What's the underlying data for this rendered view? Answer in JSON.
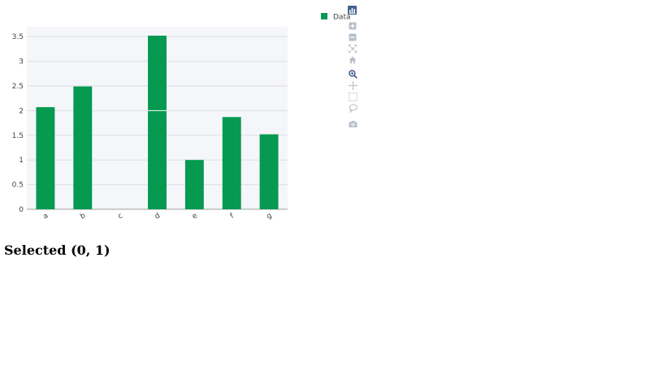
{
  "chart_data": {
    "type": "bar",
    "categories": [
      "a",
      "b",
      "c",
      "d",
      "e",
      "f",
      "g"
    ],
    "series": [
      {
        "name": "Data",
        "values": [
          2.07,
          2.49,
          null,
          3.52,
          1.0,
          1.87,
          1.52
        ]
      }
    ],
    "selected_bar_divider_at": 2.0,
    "ylim": [
      0,
      3.7
    ],
    "yticks": [
      0,
      0.5,
      1,
      1.5,
      2,
      2.5,
      3,
      3.5
    ],
    "ytick_labels": [
      "0",
      "0.5",
      "1",
      "1.5",
      "2",
      "2.5",
      "3",
      "3.5"
    ],
    "xtick_labels": [
      "a",
      "b",
      "c",
      "d",
      "e",
      "f",
      "g"
    ],
    "bar_color": "#069950",
    "plot_bg": "#f5f6f9",
    "grid": true,
    "legend": {
      "placement": "top-right",
      "entries": [
        "Data"
      ]
    }
  },
  "modebar": {
    "icons": [
      "bar-chart-icon",
      "zoom-in-icon",
      "zoom-out-icon",
      "autoscale-icon",
      "home-icon",
      "zoom-icon",
      "pan-icon",
      "box-select-icon",
      "lasso-icon",
      "camera-icon"
    ],
    "active_color": "#44618a"
  },
  "status": {
    "selected_text": "Selected (0, 1)"
  }
}
